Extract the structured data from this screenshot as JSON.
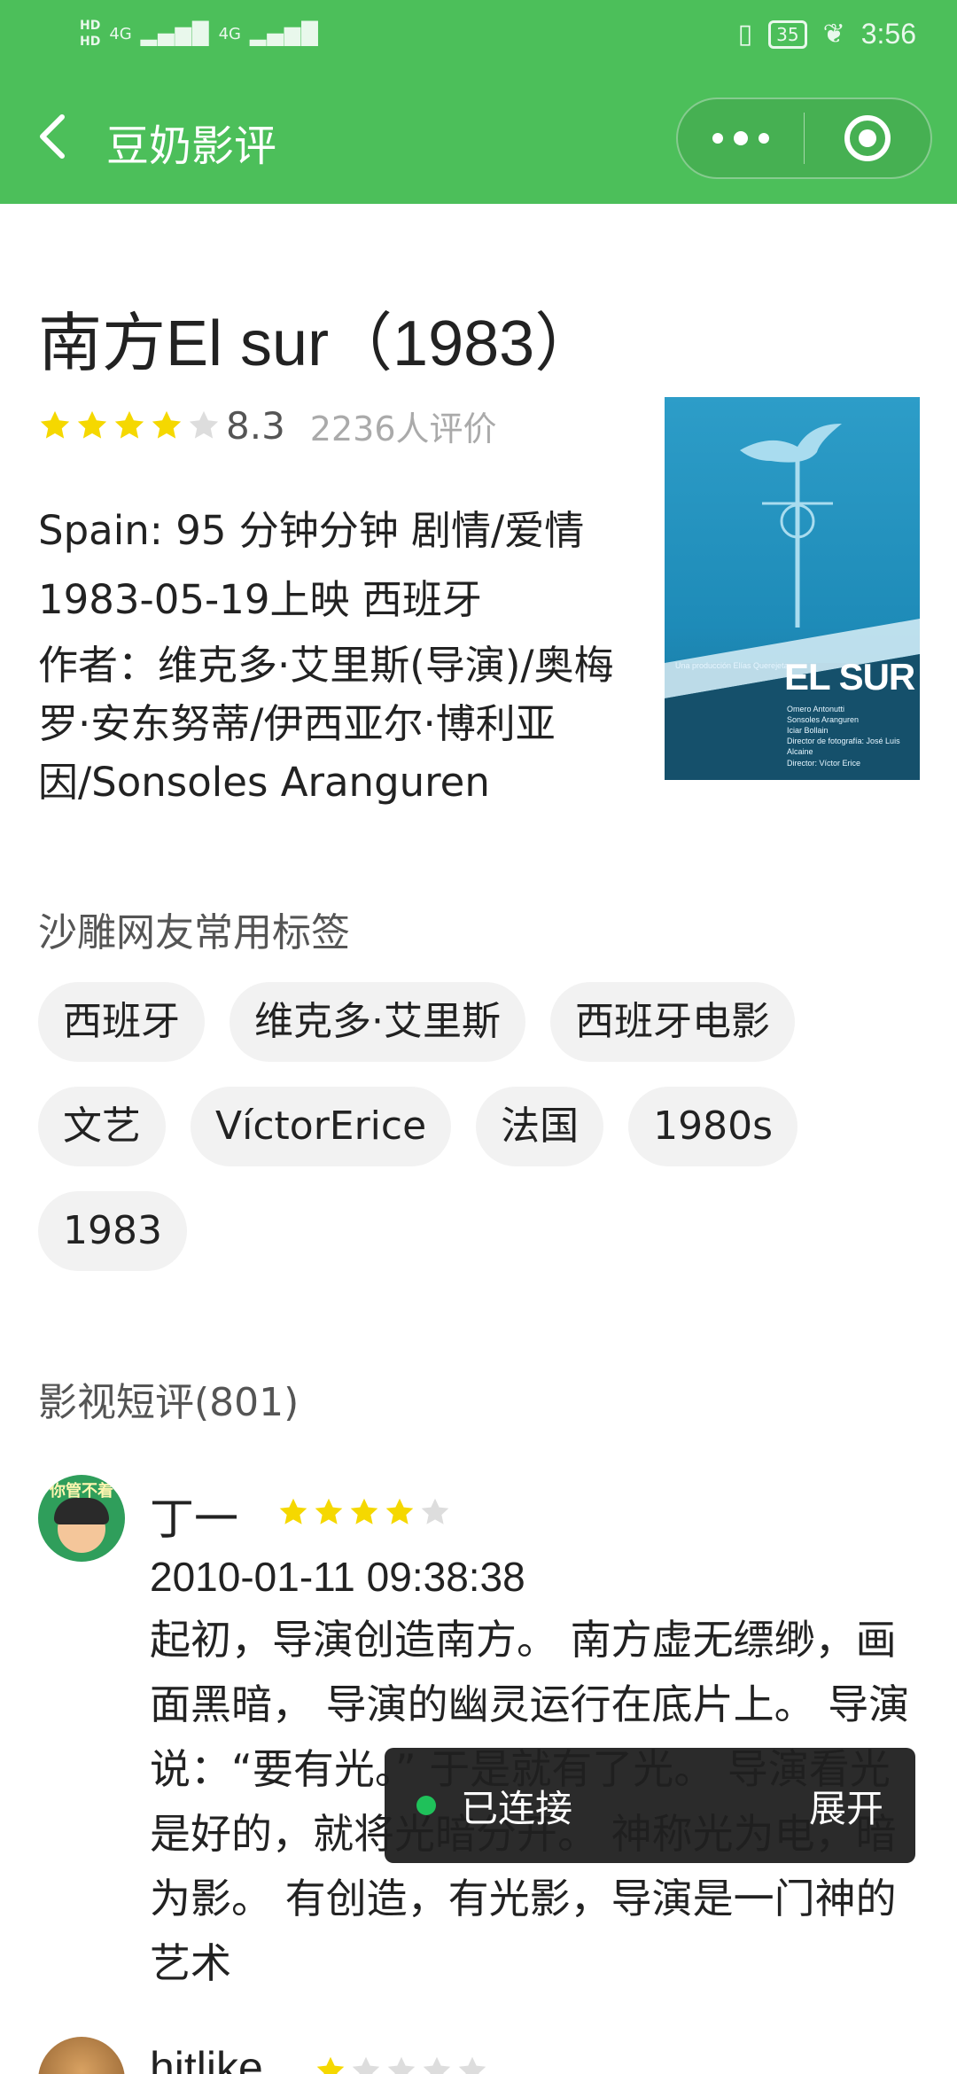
{
  "status_bar": {
    "left_icons": [
      "HD",
      "HD",
      "4G",
      "4G"
    ],
    "battery": "35",
    "time": "3:56"
  },
  "nav": {
    "title": "豆奶影评"
  },
  "movie": {
    "title": "南方El sur（1983）",
    "rating_stars": 4,
    "score": "8.3",
    "votes": "2236人评价",
    "info_line1": "Spain: 95 分钟分钟 剧情/爱情",
    "info_line2": "1983-05-19上映 西班牙",
    "info_line3": "作者：维克多·艾里斯(导演)/奥梅罗·安东努蒂/伊西亚尔·博利亚因/Sonsoles Aranguren",
    "poster": {
      "top_caption": "Una producción Elías Querejeta",
      "title": "EL SUR",
      "credits": [
        "Omero Antonutti",
        "Sonsoles Aranguren",
        "Iciar Bollain",
        "Director de fotografía: José Luis Alcaine"
      ],
      "director": "Director: Víctor Erice"
    }
  },
  "tags": {
    "heading": "沙雕网友常用标签",
    "items": [
      "西班牙",
      "维克多·艾里斯",
      "西班牙电影",
      "文艺",
      "VíctorErice",
      "法国",
      "1980s",
      "1983"
    ]
  },
  "reviews": {
    "heading": "影视短评(801)",
    "items": [
      {
        "avatar_text": "你管不着",
        "author": "丁一",
        "stars": 4,
        "time": "2010-01-11 09:38:38",
        "text": "起初，导演创造南方。 南方虚无缥缈，画面黑暗， 导演的幽灵运行在底片上。 导演说：“要有光。” 于是就有了光。 导演看光是好的，就将光暗分开。 神称光为电，暗为影。 有创造，有光影，导演是一门神的艺术"
      },
      {
        "author": "hitlike",
        "stars": 1
      }
    ]
  },
  "toast": {
    "status": "已连接",
    "action": "展开"
  },
  "colors": {
    "header_green": "#4cbf5a",
    "star_gold": "#f5d800",
    "star_gray": "#dddddd",
    "toast_dot": "#1fc15a"
  }
}
